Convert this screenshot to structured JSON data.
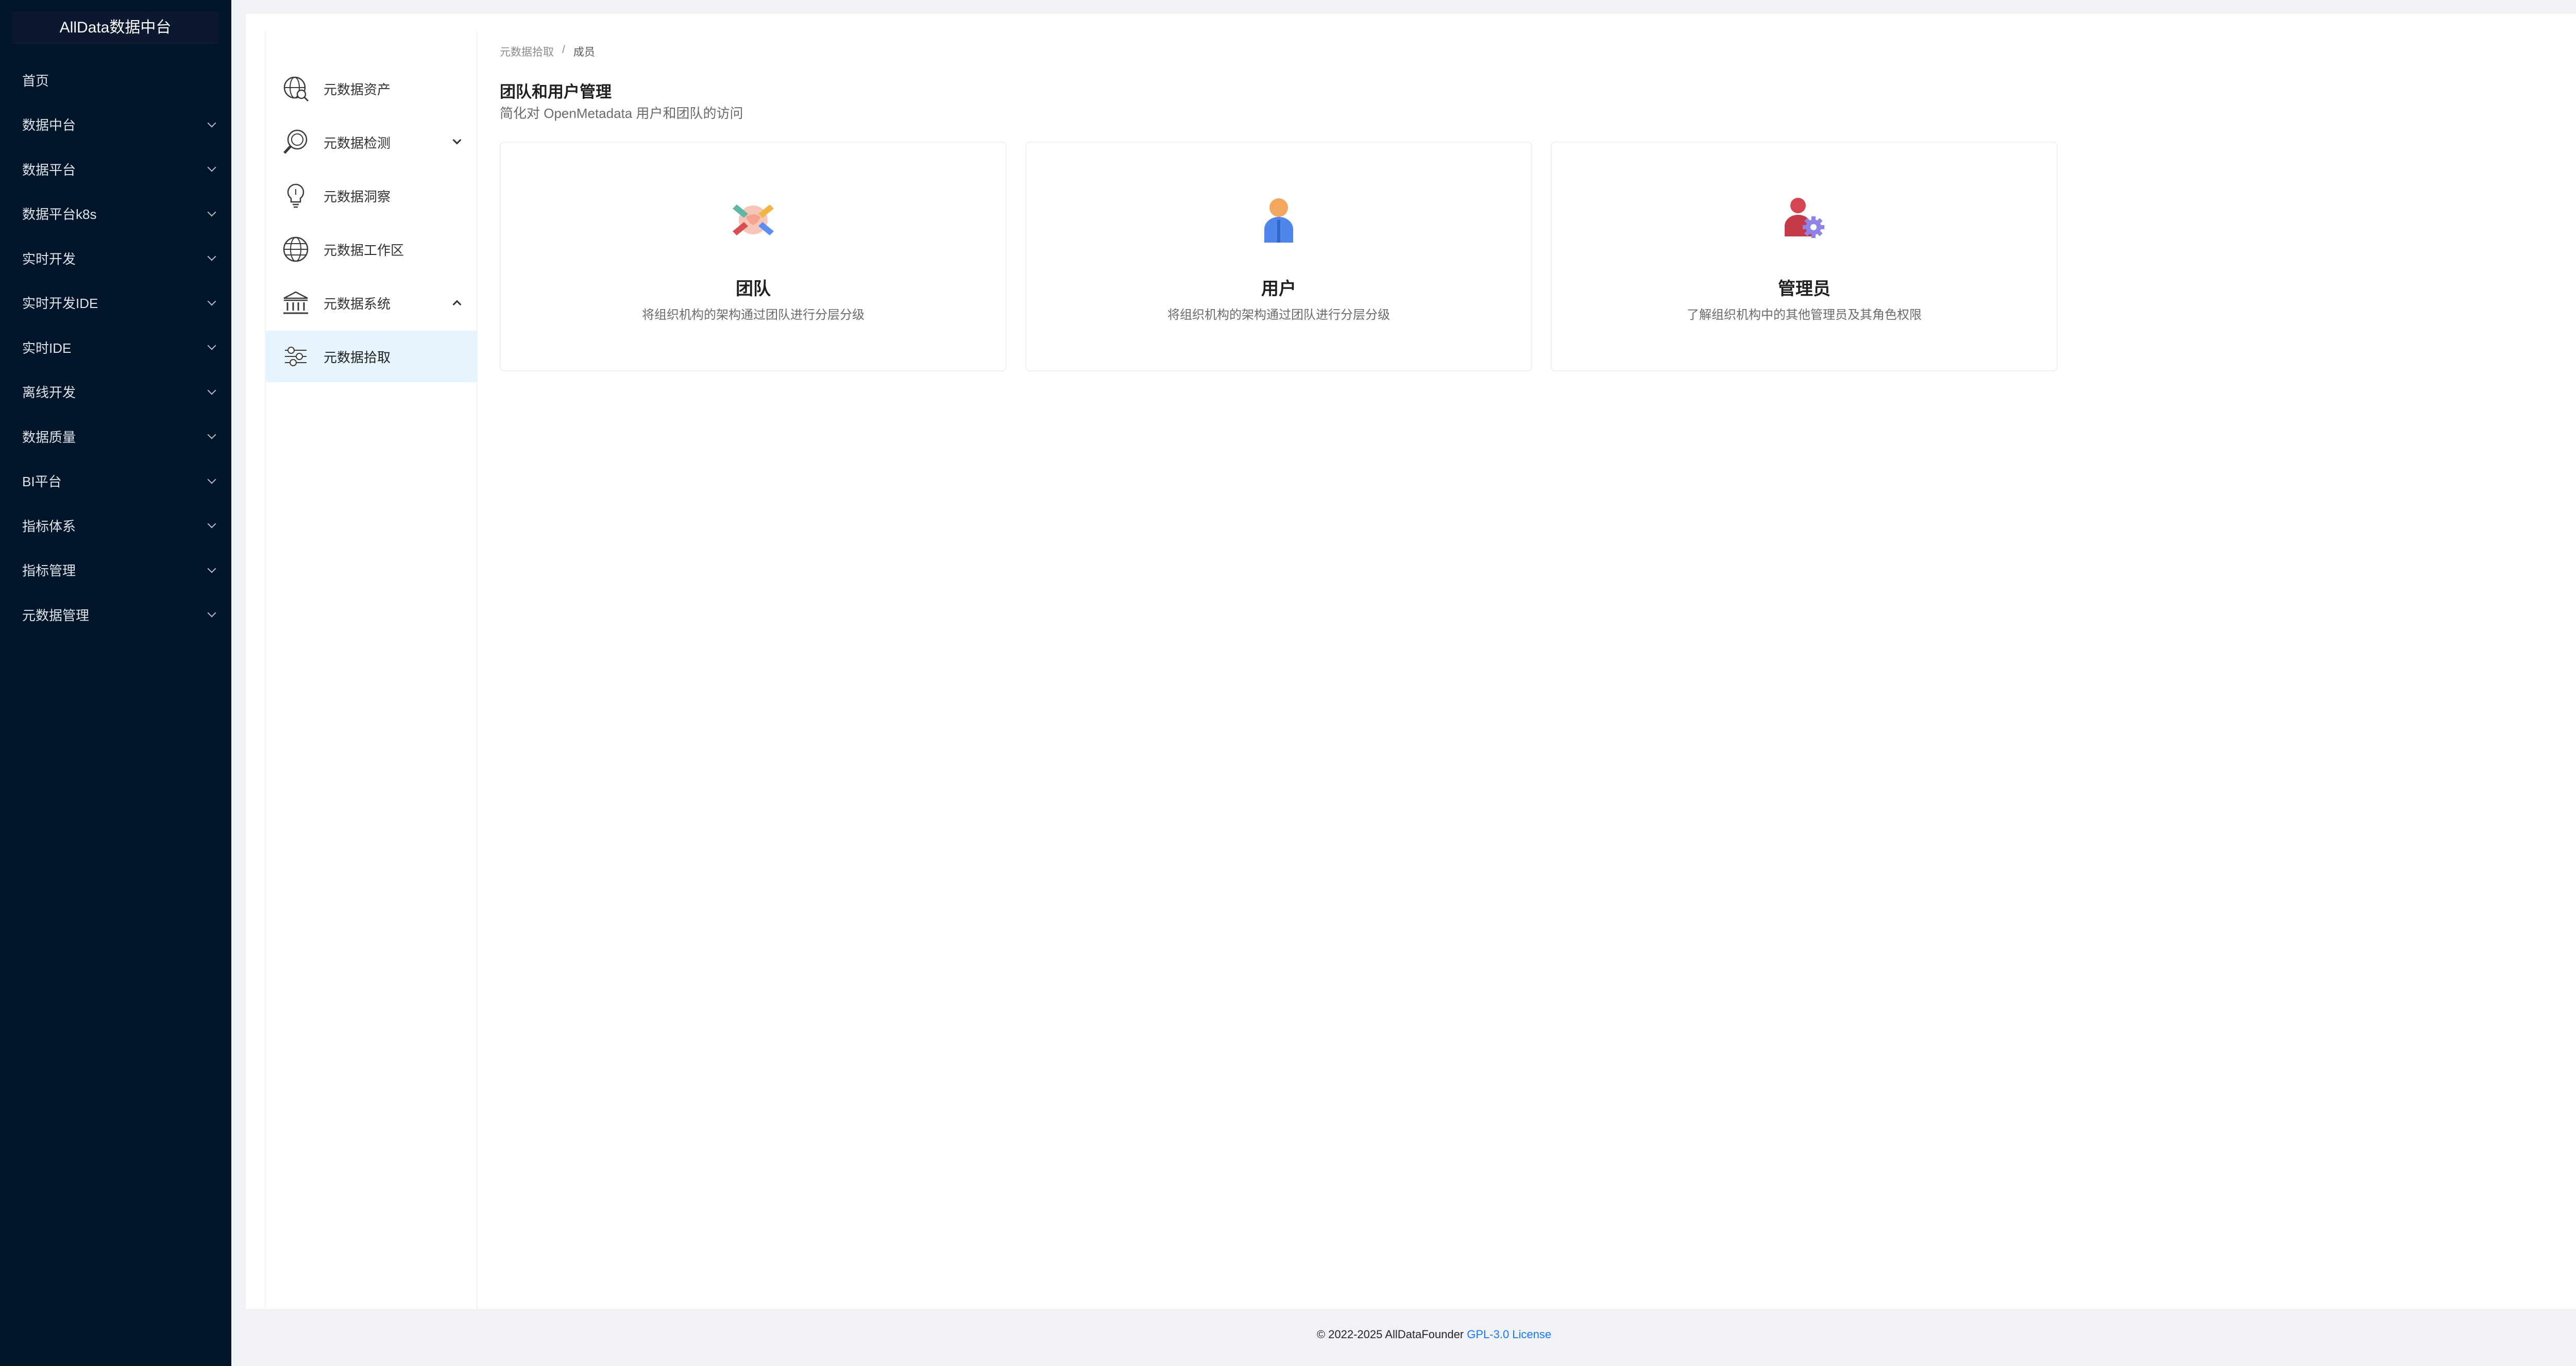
{
  "app": {
    "title": "AllData数据中台"
  },
  "sidebar": {
    "items": [
      {
        "label": "首页",
        "has_children": false
      },
      {
        "label": "数据中台",
        "has_children": true
      },
      {
        "label": "数据平台",
        "has_children": true
      },
      {
        "label": "数据平台k8s",
        "has_children": true
      },
      {
        "label": "实时开发",
        "has_children": true
      },
      {
        "label": "实时开发IDE",
        "has_children": true
      },
      {
        "label": "实时IDE",
        "has_children": true
      },
      {
        "label": "离线开发",
        "has_children": true
      },
      {
        "label": "数据质量",
        "has_children": true
      },
      {
        "label": "BI平台",
        "has_children": true
      },
      {
        "label": "指标体系",
        "has_children": true
      },
      {
        "label": "指标管理",
        "has_children": true
      },
      {
        "label": "元数据管理",
        "has_children": true
      }
    ]
  },
  "submenu": {
    "items": [
      {
        "label": "元数据资产",
        "icon": "globe-search-icon"
      },
      {
        "label": "元数据检测",
        "icon": "magnifier-icon",
        "expanded": false
      },
      {
        "label": "元数据洞察",
        "icon": "lightbulb-icon"
      },
      {
        "label": "元数据工作区",
        "icon": "globe-icon"
      },
      {
        "label": "元数据系统",
        "icon": "bank-icon",
        "expanded": true
      },
      {
        "label": "元数据拾取",
        "icon": "sliders-icon",
        "active": true
      }
    ]
  },
  "breadcrumb": {
    "parent": "元数据拾取",
    "separator": "/",
    "current": "成员"
  },
  "page": {
    "title": "团队和用户管理",
    "subtitle": "简化对 OpenMetadata 用户和团队的访问"
  },
  "cards": [
    {
      "title": "团队",
      "desc": "将组织机构的架构通过团队进行分层分级",
      "icon": "team-handshake-icon"
    },
    {
      "title": "用户",
      "desc": "将组织机构的架构通过团队进行分层分级",
      "icon": "user-icon"
    },
    {
      "title": "管理员",
      "desc": "了解组织机构中的其他管理员及其角色权限",
      "icon": "admin-gear-icon"
    }
  ],
  "footer": {
    "copyright": "© 2022-2025 AllDataFounder",
    "license": "GPL-3.0 License"
  },
  "colors": {
    "sidebar_bg": "#001529",
    "accent": "#1677ff",
    "active_bg": "#e6f4ff"
  }
}
